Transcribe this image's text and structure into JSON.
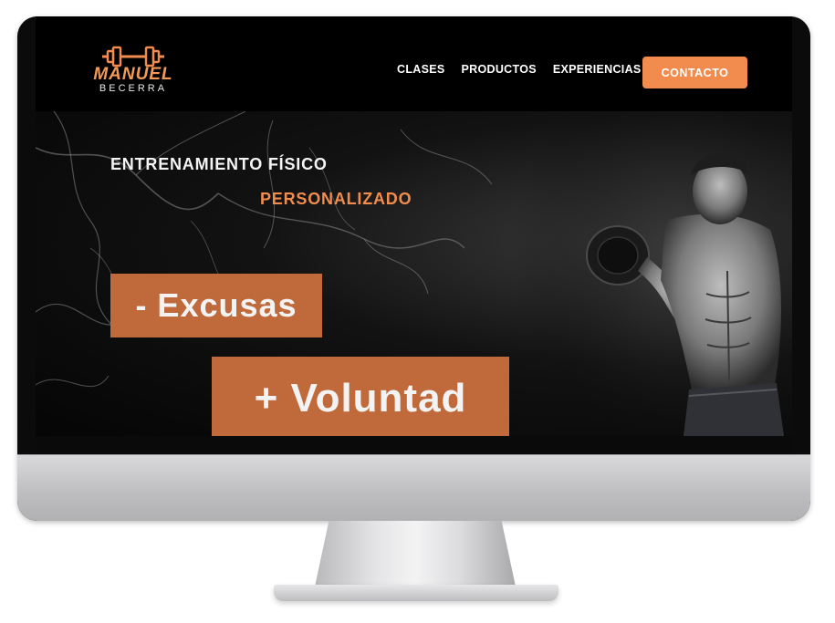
{
  "brand": {
    "name": "MANUEL",
    "sub": "BECERRA",
    "accent_color": "#f28c4e",
    "icon": "dumbbell-icon"
  },
  "nav": {
    "items": [
      {
        "label": "CLASES"
      },
      {
        "label": "PRODUCTOS"
      },
      {
        "label": "EXPERIENCIAS"
      }
    ],
    "cta_label": "CONTACTO"
  },
  "hero": {
    "heading_line1": "ENTRENAMIENTO FÍSICO",
    "heading_line2": "PERSONALIZADO",
    "box1": "- Excusas",
    "box2": "+ Voluntad",
    "box_color": "#c06a3c"
  }
}
